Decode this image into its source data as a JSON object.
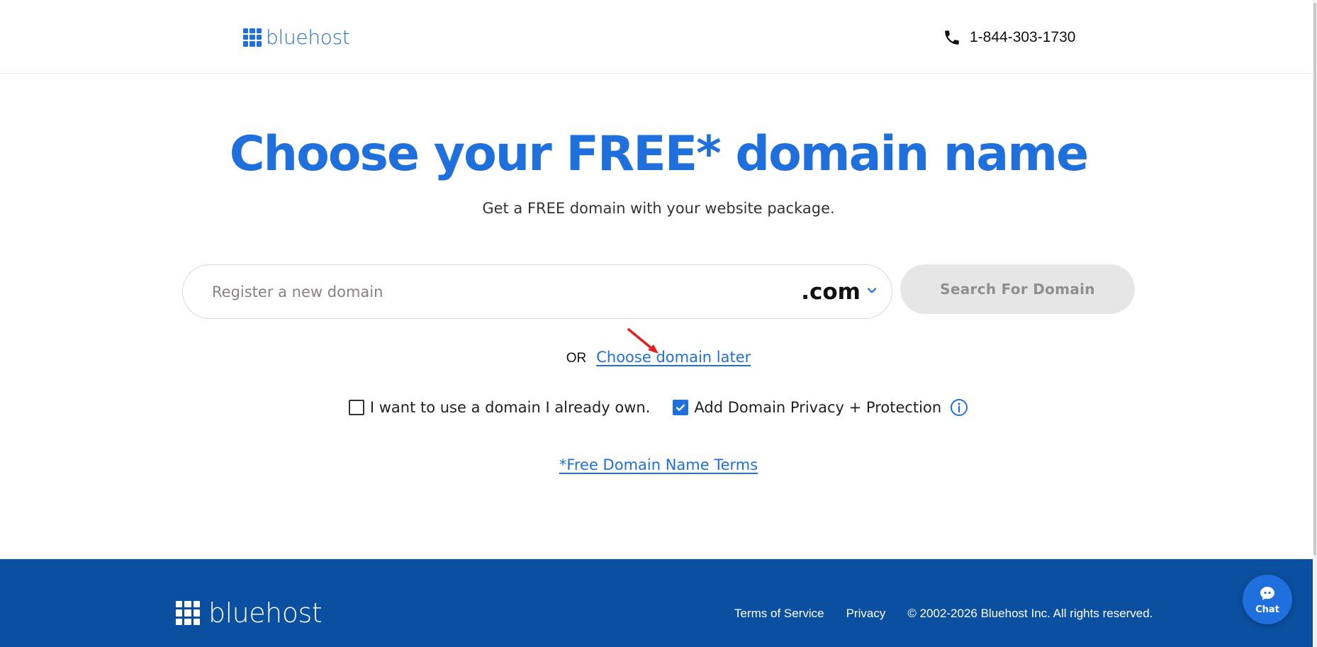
{
  "header": {
    "logo_text": "bluehost",
    "phone": "1-844-303-1730"
  },
  "hero": {
    "title": "Choose your FREE* domain name",
    "subtitle": "Get a FREE domain with your website package."
  },
  "search": {
    "placeholder": "Register a new domain",
    "tld": ".com",
    "button_label": "Search For Domain"
  },
  "alternate": {
    "or_text": "OR",
    "later_link": "Choose domain later"
  },
  "options": {
    "own_domain_label": "I want to use a domain I already own.",
    "own_domain_checked": false,
    "privacy_label": "Add Domain Privacy + Protection",
    "privacy_checked": true
  },
  "terms_link": "*Free Domain Name Terms",
  "footer": {
    "logo_text": "bluehost",
    "links": [
      "Terms of Service",
      "Privacy"
    ],
    "copyright": "© 2002-2026 Bluehost Inc. All rights reserved."
  },
  "chat": {
    "label": "Chat"
  },
  "colors": {
    "brand_blue": "#1f6fdc",
    "footer_blue": "#0b4fa0",
    "button_disabled_bg": "#e6e6e6",
    "annotation_red": "#e02020"
  },
  "icons": [
    "grid-logo-icon",
    "phone-icon",
    "chevron-down-icon",
    "checkbox-icon",
    "checkmark-icon",
    "info-icon",
    "chat-bubble-icon",
    "red-arrow-annotation-icon"
  ]
}
